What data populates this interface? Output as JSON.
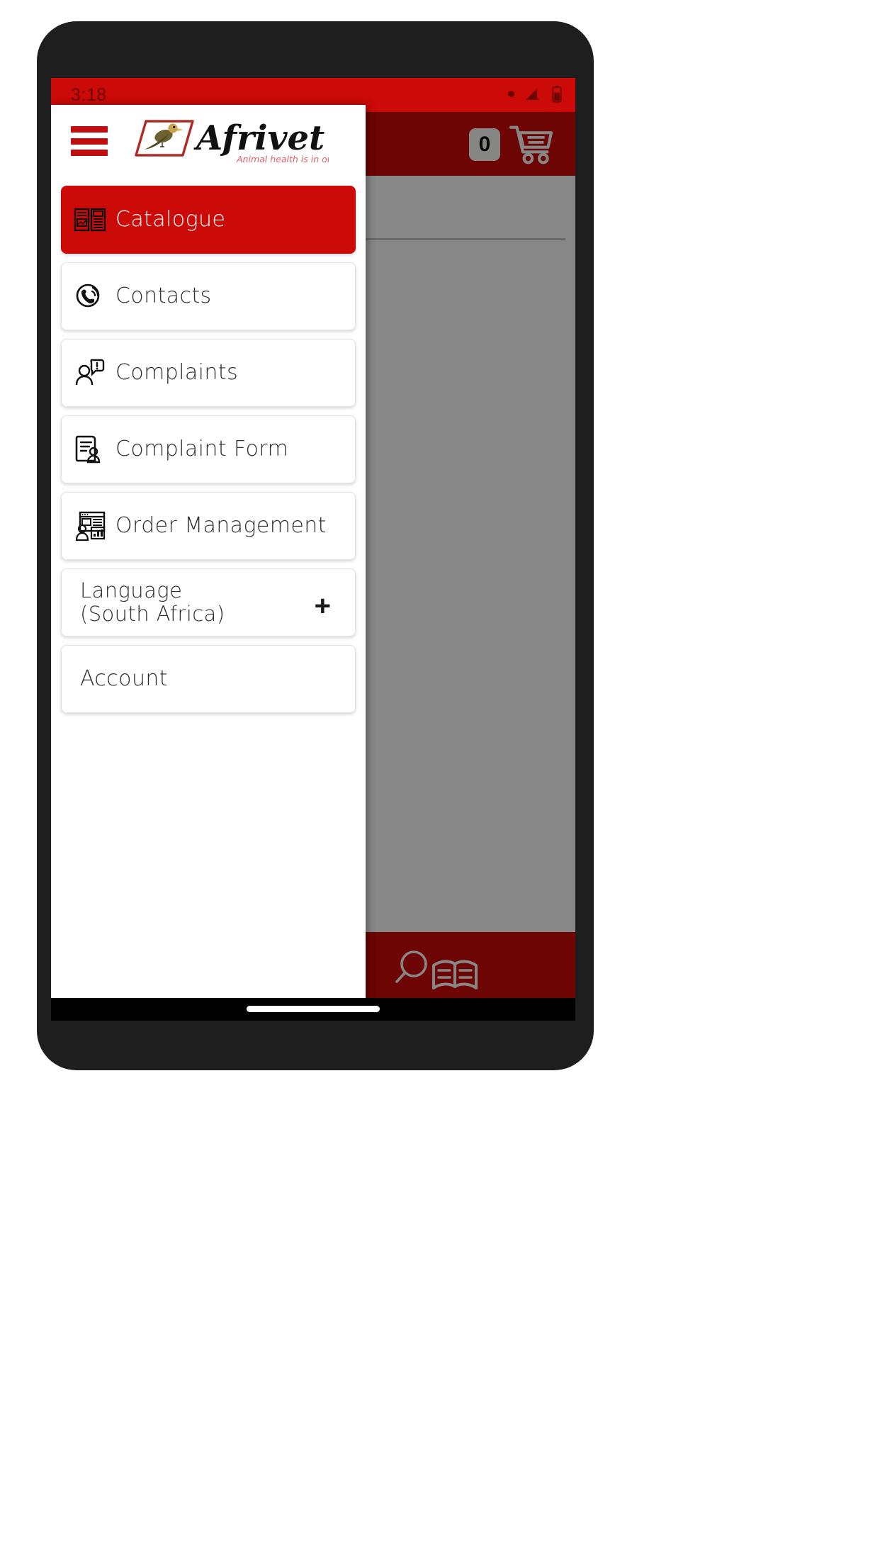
{
  "status_bar": {
    "time": "3:18",
    "icons": [
      "dot-icon",
      "no-signal-icon",
      "battery-icon"
    ]
  },
  "app_bar": {
    "cart_count": "0",
    "cart_icon": "shopping-cart-icon"
  },
  "drawer": {
    "menu_icon": "hamburger-menu-icon",
    "logo": {
      "brand": "Afrivet",
      "tagline": "Animal health is in our DNA",
      "bird_icon": "oxpecker-bird-icon"
    },
    "items": [
      {
        "label": "Catalogue",
        "icon": "open-book-icon",
        "active": true,
        "expander": ""
      },
      {
        "label": "Contacts",
        "icon": "phone-ring-icon",
        "active": false,
        "expander": ""
      },
      {
        "label": "Complaints",
        "icon": "person-speech-icon",
        "active": false,
        "expander": ""
      },
      {
        "label": "Complaint Form",
        "icon": "document-person-icon",
        "active": false,
        "expander": ""
      },
      {
        "label": "Order Management",
        "icon": "dashboard-person-icon",
        "active": false,
        "expander": ""
      }
    ],
    "language_item": {
      "line1": "Language",
      "line2": "(South Africa)",
      "expander": "+"
    },
    "account_item": {
      "label": "Account"
    }
  },
  "bottom_bar": {
    "tabs": [
      {
        "icon": "search-animal-icon"
      },
      {
        "icon": "search-book-icon"
      }
    ]
  },
  "colors": {
    "brand_red": "#cc0a08",
    "status_red_dark": "#6e0403",
    "scrim": "rgba(0,0,0,0.47)",
    "card_border": "#e4e4e4",
    "text": "#2f2f2f"
  }
}
